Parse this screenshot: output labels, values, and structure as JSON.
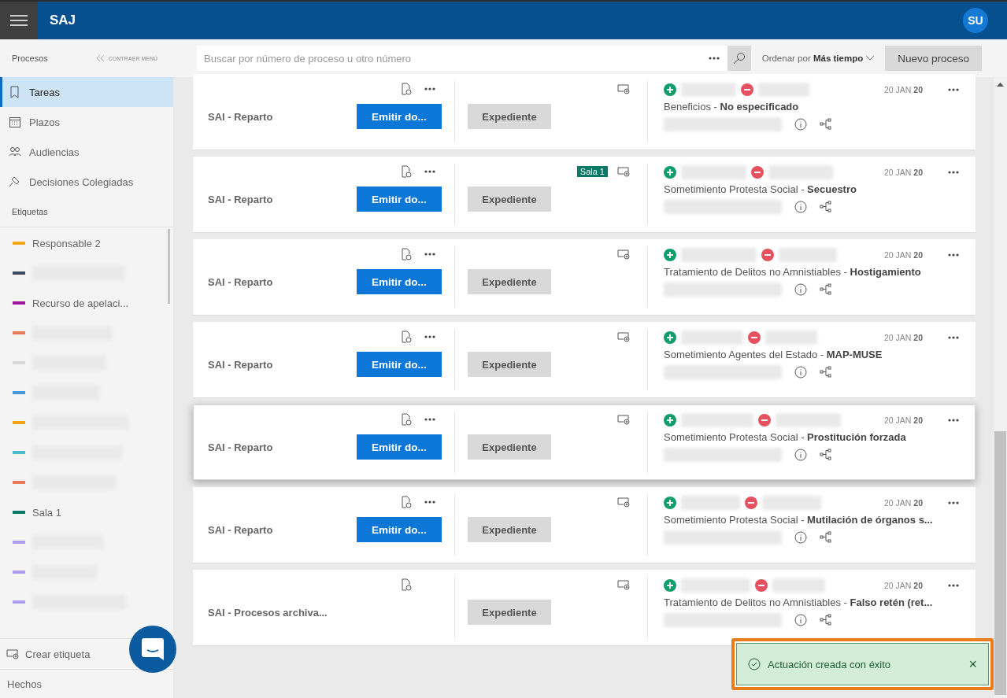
{
  "app": {
    "title": "SAJ",
    "avatar": "SU"
  },
  "sidebar": {
    "section": "Procesos",
    "collapse": "CONTRAER MENÚ",
    "items": [
      {
        "label": "Tareas",
        "selected": true
      },
      {
        "label": "Plazos",
        "selected": false
      },
      {
        "label": "Audiencias",
        "selected": false
      },
      {
        "label": "Decisiones Colegiadas",
        "selected": false
      }
    ],
    "tags_title": "Etiquetas",
    "tags": [
      {
        "label": "Responsable 2",
        "color": "#f2a516"
      },
      {
        "color": "#3b4a5c",
        "redacted": true
      },
      {
        "label": "Recurso de apelaci...",
        "color": "#a0159a"
      },
      {
        "color": "#e8795a",
        "redacted": true
      },
      {
        "color": "#d8d8d8",
        "redacted": true
      },
      {
        "color": "#4a97d4",
        "redacted": true
      },
      {
        "color": "#f2a516",
        "redacted": true
      },
      {
        "color": "#4bbcc9",
        "redacted": true
      },
      {
        "color": "#e8795a",
        "redacted": true
      },
      {
        "label": "Sala 1",
        "color": "#0a7a66"
      },
      {
        "color": "#ad9cf0",
        "redacted": true
      },
      {
        "color": "#ad9cf0",
        "redacted": true
      },
      {
        "color": "#ad9cf0",
        "redacted": true
      }
    ],
    "create_tag": "Crear etiqueta",
    "footer": "Hechos"
  },
  "toolbar": {
    "search_placeholder": "Buscar por número de proceso u otro número",
    "sort_label": "Ordenar por",
    "sort_value": "Más tiempo",
    "new_button": "Nuevo proceso"
  },
  "cards": [
    {
      "title": "SAI - Reparto",
      "action": "Emitir do...",
      "file_button": "Expediente",
      "subject": "Beneficios - **No especificado**",
      "date": "20 JAN **20**",
      "highlighted": false
    },
    {
      "title": "SAI - Reparto",
      "action": "Emitir do...",
      "file_button": "Expediente",
      "tag": {
        "label": "Sala 1",
        "color": "#0a7a66"
      },
      "subject": "Sometimiento Protesta Social - **Secuestro**",
      "date": "20 JAN **20**",
      "highlighted": false
    },
    {
      "title": "SAI - Reparto",
      "action": "Emitir do...",
      "file_button": "Expediente",
      "subject": "Tratamiento de Delitos no Amnistiables - **Hostigamiento**",
      "date": "20 JAN **20**",
      "highlighted": false
    },
    {
      "title": "SAI - Reparto",
      "action": "Emitir do...",
      "file_button": "Expediente",
      "subject": "Sometimiento Agentes del Estado - **MAP-MUSE**",
      "date": "20 JAN **20**",
      "highlighted": false
    },
    {
      "title": "SAI - Reparto",
      "action": "Emitir do...",
      "file_button": "Expediente",
      "subject": "Sometimiento Protesta Social - **Prostitución forzada**",
      "date": "20 JAN **20**",
      "highlighted": true
    },
    {
      "title": "SAI - Reparto",
      "action": "Emitir do...",
      "file_button": "Expediente",
      "subject": "Sometimiento Protesta Social - **Mutilación de órganos s...**",
      "date": "20 JAN **20**",
      "highlighted": false
    },
    {
      "title": "SAI - Procesos archiva...",
      "file_button": "Expediente",
      "subject": "Tratamiento de Delitos no Amnistiables - **Falso retén (ret...**",
      "date": "20 JAN **20**",
      "highlighted": false
    }
  ],
  "toast": {
    "message": "Actuación creada con éxito",
    "close": "×"
  }
}
